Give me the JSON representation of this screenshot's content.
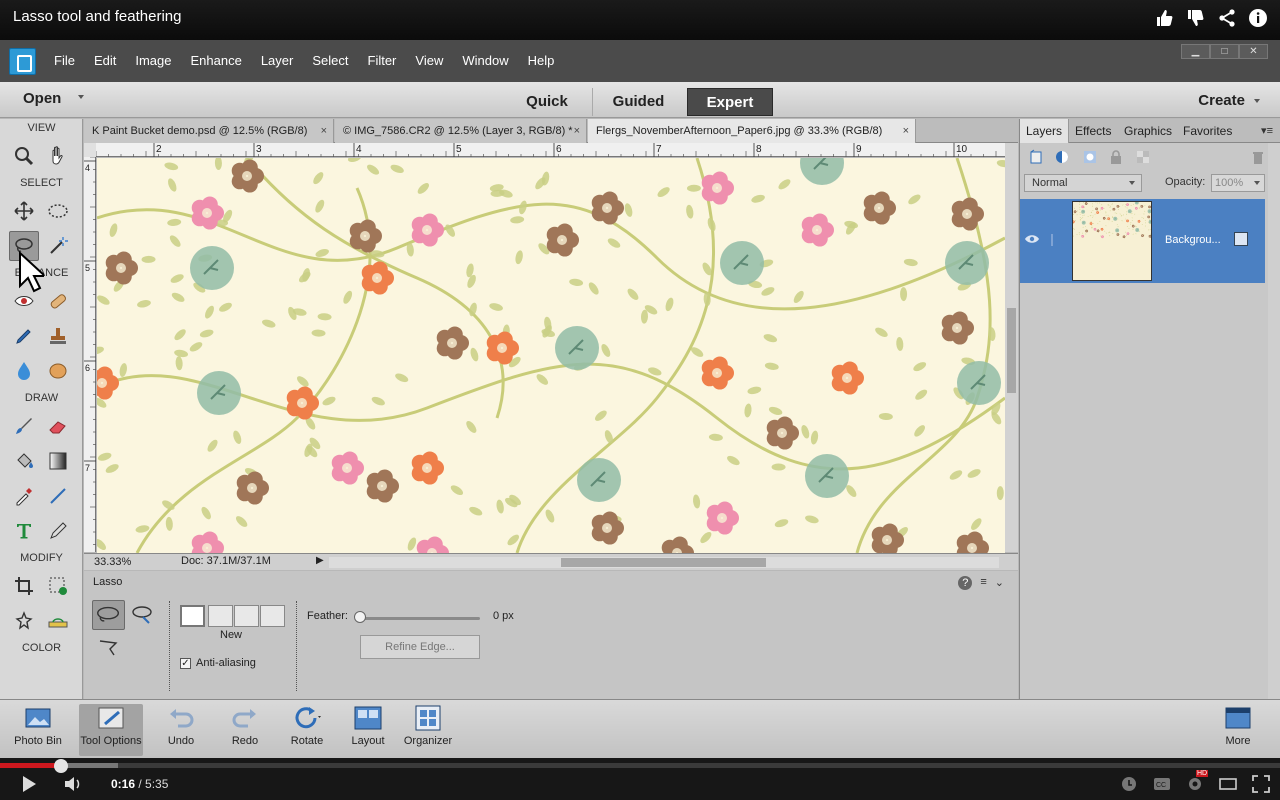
{
  "youtube": {
    "video_title": "Lasso tool and feathering",
    "current_time": "0:16",
    "duration": "/ 5:35",
    "progress_fraction": 0.048,
    "hd_badge": "HD"
  },
  "menubar": {
    "items": [
      "File",
      "Edit",
      "Image",
      "Enhance",
      "Layer",
      "Select",
      "Filter",
      "View",
      "Window",
      "Help"
    ]
  },
  "modebar": {
    "open_label": "Open",
    "modes": [
      "Quick",
      "Guided",
      "Expert"
    ],
    "active_mode": "Expert",
    "create_label": "Create"
  },
  "toolbox": {
    "sections": [
      "VIEW",
      "SELECT",
      "ENHANCE",
      "DRAW",
      "MODIFY",
      "COLOR"
    ],
    "foreground_color": "#c0262f",
    "background_color": "#ffffff"
  },
  "document_tabs": [
    {
      "label": "K Paint Bucket demo.psd @ 12.5% (RGB/8)",
      "close": "×"
    },
    {
      "label": "© IMG_7586.CR2 @ 12.5% (Layer 3, RGB/8) *",
      "close": "×"
    },
    {
      "label": "Flergs_NovemberAfternoon_Paper6.jpg @ 33.3% (RGB/8)",
      "close": "×"
    }
  ],
  "ruler": {
    "h_ticks": [
      "2",
      "3",
      "4",
      "5",
      "6",
      "7",
      "8",
      "9",
      "10"
    ],
    "v_ticks": [
      "4",
      "5",
      "6",
      "7"
    ]
  },
  "status": {
    "zoom": "33.33%",
    "doc_info": "Doc: 37.1M/37.1M"
  },
  "tool_options": {
    "tool_name": "Lasso",
    "selection_mode_label": "New",
    "anti_aliasing_label": "Anti-aliasing",
    "anti_aliasing_checked": true,
    "feather_label": "Feather:",
    "feather_value": "0 px",
    "refine_edge_label": "Refine Edge..."
  },
  "panel": {
    "tabs": [
      "Layers",
      "Effects",
      "Graphics",
      "Favorites"
    ],
    "active_tab": "Layers",
    "blend_mode": "Normal",
    "opacity_label": "Opacity:",
    "opacity_value": "100%",
    "layers": [
      {
        "name": "Backgrou..."
      }
    ]
  },
  "taskbar": {
    "buttons": [
      "Photo Bin",
      "Tool Options",
      "Undo",
      "Redo",
      "Rotate",
      "Layout",
      "Organizer",
      "More"
    ]
  },
  "colors": {
    "accent_blue": "#4b80c2",
    "yt_red": "#cc181e"
  }
}
